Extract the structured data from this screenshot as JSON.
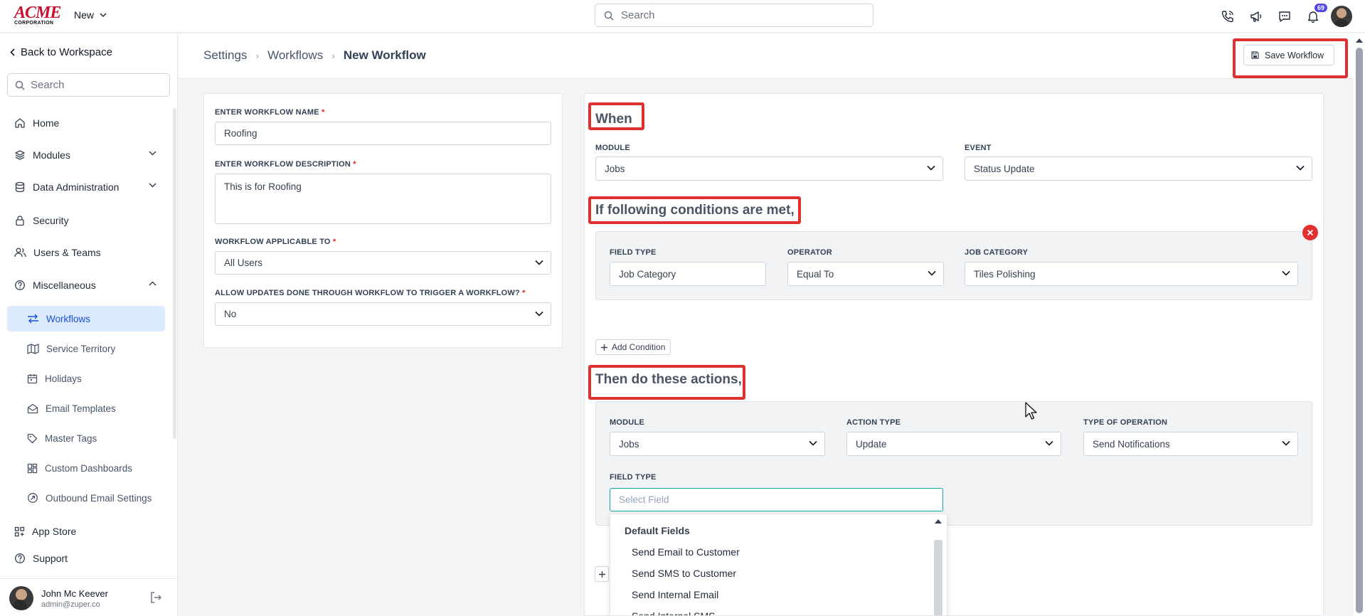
{
  "topbar": {
    "logo_big": "ACME",
    "logo_small": "CORPORATION",
    "new_label": "New",
    "search_placeholder": "Search",
    "notification_count": "69"
  },
  "sidebar": {
    "back_label": "Back to Workspace",
    "search_placeholder": "Search",
    "items": [
      {
        "label": "Home",
        "icon": "home-icon"
      },
      {
        "label": "Modules",
        "icon": "layers-icon"
      },
      {
        "label": "Data Administration",
        "icon": "database-icon"
      },
      {
        "label": "Security",
        "icon": "lock-icon"
      },
      {
        "label": "Users & Teams",
        "icon": "users-icon"
      },
      {
        "label": "Miscellaneous",
        "icon": "help-circle-icon"
      }
    ],
    "sub_items": [
      {
        "label": "Workflows",
        "icon": "arrows-icon"
      },
      {
        "label": "Service Territory",
        "icon": "map-icon"
      },
      {
        "label": "Holidays",
        "icon": "calendar-icon"
      },
      {
        "label": "Email Templates",
        "icon": "envelope-icon"
      },
      {
        "label": "Master Tags",
        "icon": "tag-icon"
      },
      {
        "label": "Custom Dashboards",
        "icon": "dashboard-icon"
      },
      {
        "label": "Outbound Email Settings",
        "icon": "outbound-icon"
      }
    ],
    "bottom_items": [
      {
        "label": "App Store",
        "icon": "apps-icon"
      },
      {
        "label": "Support",
        "icon": "help-circle-icon"
      }
    ],
    "user": {
      "name": "John Mc Keever",
      "email": "admin@zuper.co"
    }
  },
  "header": {
    "breadcrumb": [
      "Settings",
      "Workflows",
      "New Workflow"
    ],
    "save_label": "Save Workflow"
  },
  "form": {
    "name_label": "ENTER WORKFLOW NAME",
    "name_value": "Roofing",
    "desc_label": "ENTER WORKFLOW DESCRIPTION",
    "desc_value": "This is for Roofing",
    "applicable_label": "WORKFLOW APPLICABLE TO",
    "applicable_value": "All Users",
    "allow_label": "ALLOW UPDATES DONE THROUGH WORKFLOW TO TRIGGER A WORKFLOW?",
    "allow_value": "No",
    "required_mark": "*"
  },
  "when": {
    "title": "When",
    "module_label": "MODULE",
    "module_value": "Jobs",
    "event_label": "EVENT",
    "event_value": "Status Update"
  },
  "conditions": {
    "title": "If following conditions are met,",
    "field_type_label": "FIELD TYPE",
    "field_type_value": "Job Category",
    "operator_label": "OPERATOR",
    "operator_value": "Equal To",
    "job_category_label": "JOB CATEGORY",
    "job_category_value": "Tiles Polishing",
    "add_label": "Add Condition"
  },
  "actions": {
    "title": "Then do these actions,",
    "module_label": "MODULE",
    "module_value": "Jobs",
    "action_type_label": "ACTION TYPE",
    "action_type_value": "Update",
    "operation_label": "TYPE OF OPERATION",
    "operation_value": "Send Notifications",
    "field_type_label": "FIELD TYPE",
    "field_type_placeholder": "Select Field",
    "dropdown_group": "Default Fields",
    "dropdown_options": [
      "Send Email to Customer",
      "Send SMS to Customer",
      "Send Internal Email",
      "Send Internal SMS"
    ]
  },
  "colors": {
    "highlight": "#e03131",
    "active_nav": "#dbeafe",
    "focus": "#0ea5a5"
  }
}
